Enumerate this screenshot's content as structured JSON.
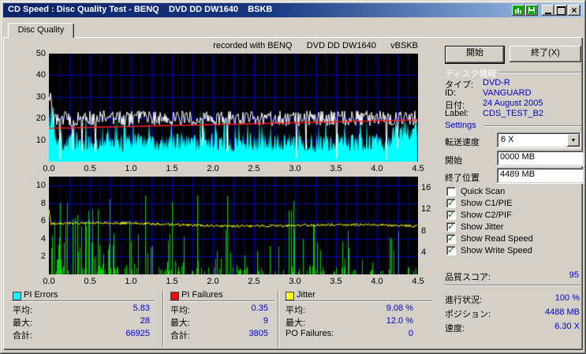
{
  "window": {
    "title": "CD Speed : Disc Quality Test - BENQ    DVD DD DW1640    BSKB"
  },
  "tabs": {
    "disc_quality": "Disc Quality"
  },
  "chart_header": "recorded with BENQ      DVD DD DW1640      vBSKB",
  "actions": {
    "start": "開始",
    "exit": "終了(X)"
  },
  "disc_info": {
    "header": "ディスク情報",
    "type_label": "タイプ:",
    "type_value": "DVD-R",
    "id_label": "ID:",
    "id_value": "VANGUARD",
    "date_label": "日付:",
    "date_value": "24 August 2005",
    "label_label": "Label:",
    "label_value": "CDS_TEST_B2"
  },
  "settings": {
    "header": "Settings",
    "speed_label": "転送速度",
    "speed_value": "6 X",
    "start_label": "開始",
    "start_value": "0000 MB",
    "end_label": "終了位置",
    "end_value": "4489 MB",
    "checkboxes": [
      {
        "label": "Quick Scan",
        "checked": false
      },
      {
        "label": "Show C1/PIE",
        "checked": true
      },
      {
        "label": "Show C2/PIF",
        "checked": true
      },
      {
        "label": "Show Jitter",
        "checked": true
      },
      {
        "label": "Show Read Speed",
        "checked": true
      },
      {
        "label": "Show Write Speed",
        "checked": true
      }
    ],
    "score_label": "品質スコア:",
    "score_value": "95"
  },
  "status": {
    "progress_label": "進行状況:",
    "progress_value": "100 %",
    "position_label": "ポジション:",
    "position_value": "4488 MB",
    "speed_label": "速度:",
    "speed_value": "6.30 X"
  },
  "legend": {
    "panels": [
      {
        "title": "PI Errors",
        "color": "#00ffff",
        "rows": [
          {
            "label": "平均:",
            "value": "5.83"
          },
          {
            "label": "最大:",
            "value": "28"
          },
          {
            "label": "合計:",
            "value": "66925"
          }
        ]
      },
      {
        "title": "PI Failures",
        "color": "#ff0000",
        "rows": [
          {
            "label": "平均:",
            "value": "0.35"
          },
          {
            "label": "最大:",
            "value": "9"
          },
          {
            "label": "合計:",
            "value": "3805"
          }
        ]
      },
      {
        "title": "Jitter",
        "color": "#ffff00",
        "rows": [
          {
            "label": "平均:",
            "value": "9.08 %"
          },
          {
            "label": "最大:",
            "value": "12.0 %"
          },
          {
            "label": "PO Failures:",
            "value": "0"
          }
        ]
      }
    ]
  },
  "chart_data": [
    {
      "type": "area",
      "name": "pi-errors-speed-chart",
      "bg": "#000000",
      "grid_color": "#0000bb",
      "x_range": [
        0,
        4.5
      ],
      "x_grid_step": 0.125,
      "x_ticks": [
        "0.0",
        "0.5",
        "1.0",
        "1.5",
        "2.0",
        "2.5",
        "3.0",
        "3.5",
        "4.0",
        "4.5"
      ],
      "y_range": [
        0,
        50
      ],
      "y_ticks": [
        50,
        40,
        30,
        20,
        10
      ],
      "y_grid_step": 10,
      "series": [
        {
          "name": "PI Errors",
          "style": "area",
          "color": "#00ffff",
          "base": 4.5,
          "spread": 9,
          "spike_prob": 0.1,
          "spike_add": 9,
          "start_level": 24,
          "end_level": 16,
          "stat_avg": 5.83,
          "stat_max": 28
        },
        {
          "name": "Write Speed",
          "style": "jagged-line",
          "color": "#ffffff",
          "level": 20,
          "noise": 7,
          "dip_prob": 0.05
        },
        {
          "name": "Read Speed",
          "style": "trend-line",
          "color": "#ff2222",
          "start": 15.4,
          "end": 19.3
        }
      ]
    },
    {
      "type": "bar",
      "name": "pi-failures-jitter-chart",
      "bg": "#000000",
      "grid_color": "#0000bb",
      "x_range": [
        0,
        4.5
      ],
      "x_grid_step": 0.125,
      "x_ticks": [
        "0.0",
        "0.5",
        "1.0",
        "1.5",
        "2.0",
        "2.5",
        "3.0",
        "3.5",
        "4.0",
        "4.5"
      ],
      "y_left_range": [
        0,
        11
      ],
      "y_left_ticks": [
        10,
        8,
        6,
        4,
        2
      ],
      "y_left_grid_step": 2,
      "y_right_range": [
        0,
        18
      ],
      "y_right_ticks": [
        16,
        12,
        8,
        4
      ],
      "series": [
        {
          "name": "PI Failures",
          "style": "bars",
          "color": "#00d000",
          "stat_avg": 0.35,
          "stat_max": 9,
          "regions": [
            {
              "until": 0.55,
              "density": 0.5,
              "h_min": 1.5,
              "h_max": 9
            },
            {
              "until": 1.25,
              "density": 0.28,
              "h_min": 0.5,
              "h_max": 9
            },
            {
              "until": 3.3,
              "density": 0.16,
              "h_min": 0.4,
              "h_max": 9
            },
            {
              "until": 4.5,
              "density": 0.11,
              "h_min": 0.3,
              "h_max": 5
            }
          ]
        },
        {
          "name": "Jitter",
          "style": "line",
          "color": "#ffff00",
          "axis": "right",
          "avg_pct": 9.08,
          "max_pct": 12.0
        }
      ]
    }
  ]
}
